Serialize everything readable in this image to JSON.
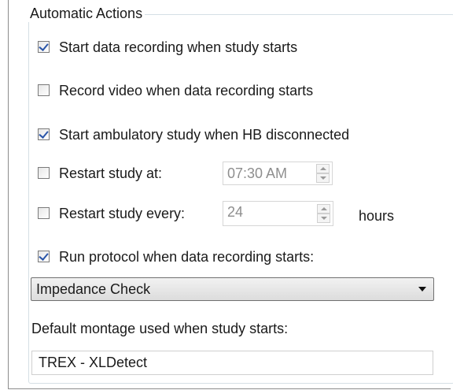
{
  "group": {
    "title": "Automatic Actions"
  },
  "options": [
    {
      "label": "Start data recording when study starts",
      "checked": true
    },
    {
      "label": "Record video when data recording starts",
      "checked": false
    },
    {
      "label": "Start ambulatory study when HB disconnected",
      "checked": true
    },
    {
      "label": "Restart study at:",
      "checked": false
    },
    {
      "label": "Restart study every:",
      "checked": false
    },
    {
      "label": "Run protocol when data recording starts:",
      "checked": true
    }
  ],
  "restart_at": {
    "value": "07:30 AM"
  },
  "restart_every": {
    "value": "24",
    "unit": "hours"
  },
  "protocol": {
    "selected": "Impedance Check"
  },
  "montage": {
    "label": "Default montage used when study starts:",
    "value": "TREX - XLDetect"
  }
}
